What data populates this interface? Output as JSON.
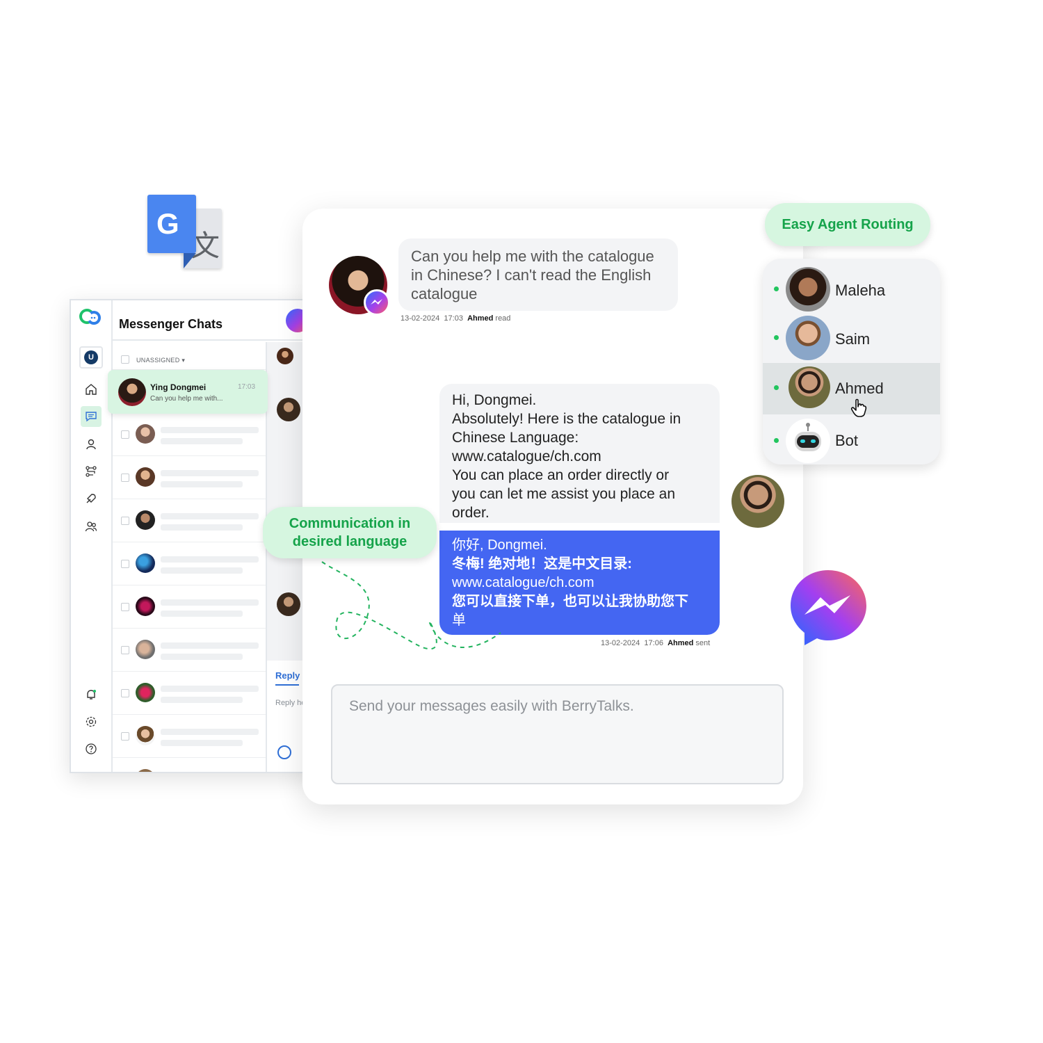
{
  "app": {
    "title": "Messenger Chats",
    "user_initial": "U",
    "filter_label": "UNASSIGNED",
    "selected_chat": {
      "name": "Ying Dongmei",
      "preview": "Can you help me with...",
      "time": "17:03"
    },
    "reply_tab": "Reply",
    "reply_placeholder": "Reply here"
  },
  "chat": {
    "incoming_message": "Can you help me with the catalogue in Chinese? I can't read the English catalogue",
    "incoming_meta": {
      "date": "13-02-2024",
      "time": "17:03",
      "agent": "Ahmed",
      "status": "read"
    },
    "outgoing_lines": [
      "Hi, Dongmei.",
      "Absolutely! Here is the catalogue in",
      "Chinese Language:",
      "www.catalogue/ch.com",
      "You can place an order directly or",
      "you can let me assist you place an",
      "order."
    ],
    "translated_lines": [
      "你好, Dongmei.",
      "冬梅! 绝对地！这是中文目录:",
      "www.catalogue/ch.com",
      "您可以直接下单，也可以让我协助您下",
      "单"
    ],
    "outgoing_meta": {
      "date": "13-02-2024",
      "time": "17:06",
      "agent": "Ahmed",
      "status": "sent"
    },
    "composer_placeholder": "Send your messages easily with BerryTalks."
  },
  "callouts": {
    "routing": "Easy Agent Routing",
    "language_line1": "Communication in",
    "language_line2": "desired language"
  },
  "agents": [
    {
      "name": "Maleha",
      "status": "online"
    },
    {
      "name": "Saim",
      "status": "online"
    },
    {
      "name": "Ahmed",
      "status": "online",
      "highlighted": true
    },
    {
      "name": "Bot",
      "status": "online"
    }
  ],
  "colors": {
    "accent_green": "#15a34a",
    "pill_bg": "#d6f6e0",
    "translated_bubble": "#4466f2",
    "online_dot": "#22c55e"
  },
  "icons": [
    "google-translate-icon",
    "messenger-icon",
    "home-icon",
    "chat-icon",
    "contact-icon",
    "routing-icon",
    "rocket-icon",
    "team-icon",
    "bell-icon",
    "settings-icon",
    "help-icon",
    "cursor-hand-icon",
    "bot-icon"
  ]
}
